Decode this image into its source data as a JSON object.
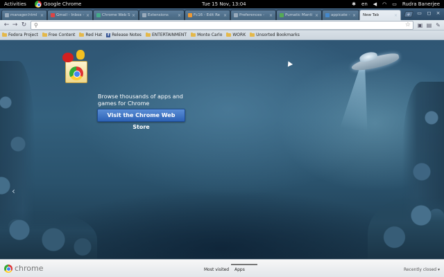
{
  "topbar": {
    "activities": "Activities",
    "app_name": "Google Chrome",
    "clock": "Tue 15 Nov, 13:04",
    "lang": "en",
    "user": "Rudra Banerjee"
  },
  "tabs": [
    {
      "label": "manager.html"
    },
    {
      "label": "Gmail - Inbox -"
    },
    {
      "label": "Chrome Web S"
    },
    {
      "label": "Extensions"
    },
    {
      "label": "Fc16 - Edit Re"
    },
    {
      "label": "Preferences -"
    },
    {
      "label": "Pumatic Manti"
    },
    {
      "label": "appicate - Goo"
    },
    {
      "label": "New Tab"
    }
  ],
  "omnibox": {
    "value": ""
  },
  "bookmarks": [
    {
      "label": "Fedora Project",
      "icon": "folder-icon"
    },
    {
      "label": "Free Content",
      "icon": "folder-icon"
    },
    {
      "label": "Red Hat",
      "icon": "folder-icon"
    },
    {
      "label": "Release Notes",
      "icon": "facebook-icon"
    },
    {
      "label": "ENTERTAINMENT",
      "icon": "folder-icon"
    },
    {
      "label": "Monte Carlo",
      "icon": "folder-icon"
    },
    {
      "label": "WORK",
      "icon": "folder-icon"
    },
    {
      "label": "Unsorted Bookmarks",
      "icon": "folder-icon"
    }
  ],
  "ntp": {
    "promo_text": "Browse thousands of apps and games for Chrome",
    "promo_button": "Visit the Chrome Web Store",
    "prev_arrow": "‹"
  },
  "footer": {
    "brand": "chrome",
    "tab_most_visited": "Most visited",
    "tab_apps": "Apps",
    "recently_closed": "Recently closed ▾"
  }
}
